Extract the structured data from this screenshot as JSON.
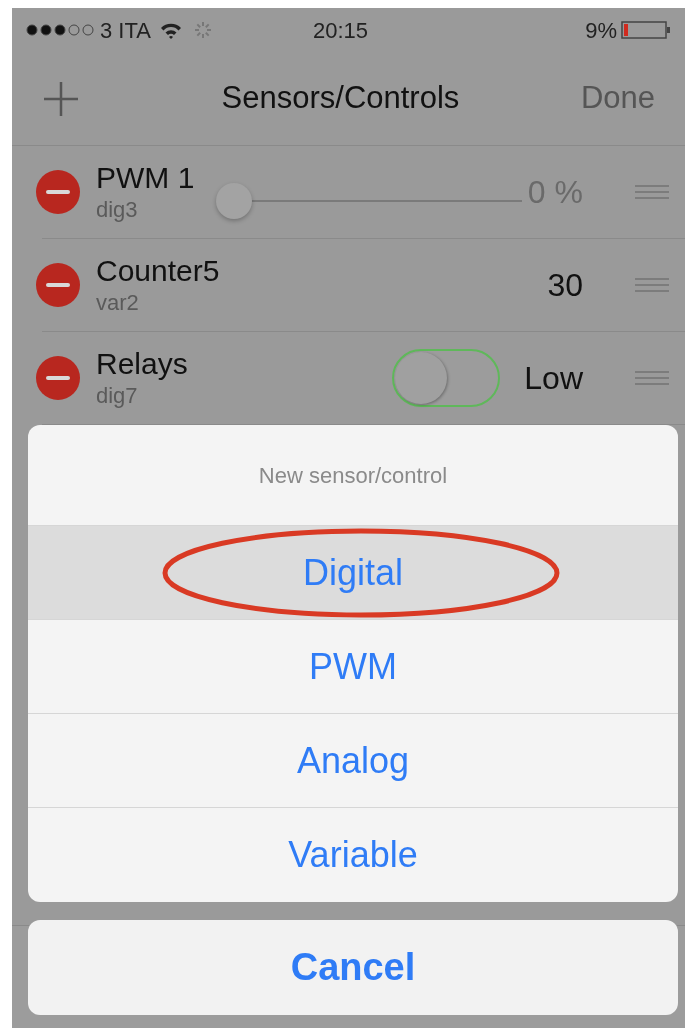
{
  "status_bar": {
    "carrier": "3 ITA",
    "time": "20:15",
    "battery": "9%"
  },
  "nav_bar": {
    "title": "Sensors/Controls",
    "done": "Done"
  },
  "rows": [
    {
      "kind": "slider",
      "name": "PWM 1",
      "pin": "dig3",
      "level": 0,
      "reading": "0 %"
    },
    {
      "kind": "value",
      "name": "Counter5",
      "pin": "var2",
      "reading": "30"
    },
    {
      "kind": "switch",
      "name": "Relays",
      "pin": "dig7",
      "on": false,
      "reading": "Low"
    }
  ],
  "action_sheet": {
    "title": "New sensor/control",
    "options": [
      {
        "label": "Digital",
        "selected": true
      },
      {
        "label": "PWM",
        "selected": false
      },
      {
        "label": "Analog",
        "selected": false
      },
      {
        "label": "Variable",
        "selected": false
      }
    ],
    "cancel": "Cancel"
  }
}
